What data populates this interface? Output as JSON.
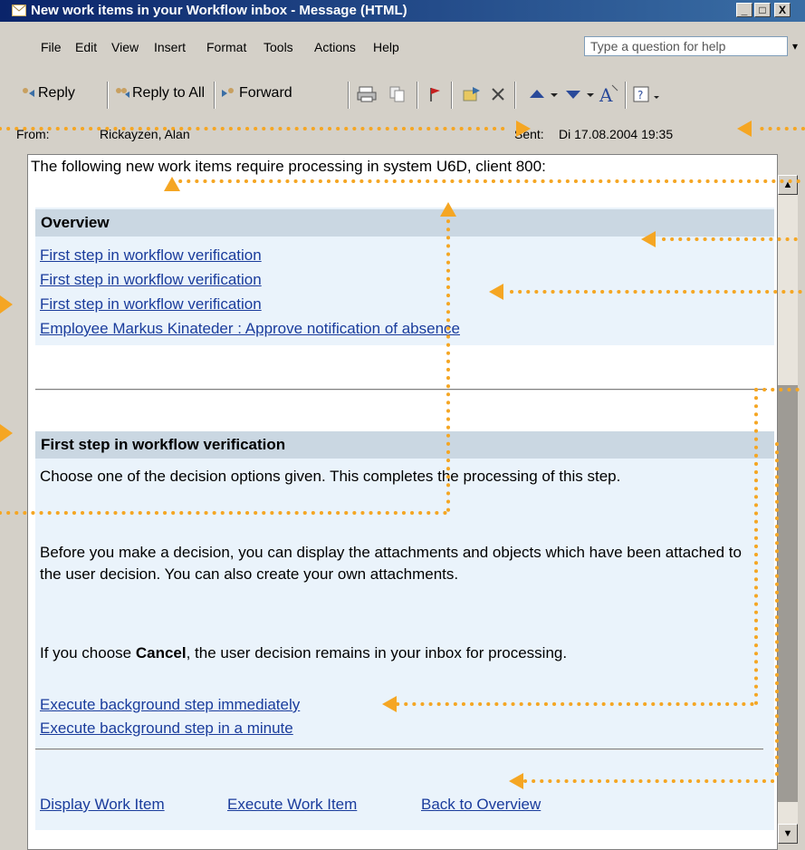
{
  "window": {
    "title": "New work items in your Workflow inbox - Message (HTML)",
    "controls": [
      "_",
      "□",
      "X"
    ]
  },
  "menu": {
    "items": [
      "File",
      "Edit",
      "View",
      "Insert",
      "Format",
      "Tools",
      "Actions",
      "Help"
    ],
    "help_placeholder": "Type a question for help"
  },
  "toolbar": {
    "reply_label": "Reply",
    "reply_all_label": "Reply to All",
    "forward_label": "Forward"
  },
  "header": {
    "from_label": "From:",
    "from_value": "Rickayzen, Alan",
    "sent_label": "Sent:",
    "sent_value": "Di 17.08.2004 19:35"
  },
  "message": {
    "intro": "The following new work items require processing in system U6D, client 800:",
    "overview": {
      "heading": "Overview",
      "links": [
        "First step in workflow verification",
        "First step in workflow verification",
        "First step in workflow verification",
        "Employee Markus Kinateder : Approve notification of absence"
      ]
    },
    "detail": {
      "heading": "First step in workflow verification",
      "para1": "Choose one of the decision options given. This completes the processing of this step.",
      "para2": "Before you make a decision, you can display the attachments and objects which have been attached to the user decision. You can also create your own attachments.",
      "para3_prefix": "If you choose ",
      "para3_bold": "Cancel",
      "para3_suffix": ", the user decision remains in your inbox for processing.",
      "decision_links": [
        "Execute background step immediately",
        "Execute background step in a minute"
      ],
      "action_links": [
        "Display Work Item",
        "Execute Work Item",
        "Back to Overview"
      ]
    }
  },
  "colors": {
    "titlebar": "#0a246a",
    "link": "#1a3c9c",
    "panel_bg": "#eaf3fb",
    "heading_bg": "#cad7e2",
    "annotation": "#f5a623"
  }
}
